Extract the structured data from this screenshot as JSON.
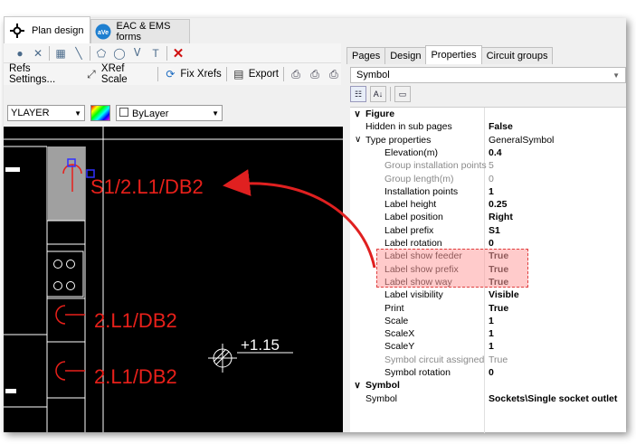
{
  "doc_tabs": [
    {
      "label": "Plan design",
      "active": true,
      "icon": "crosshair-icon"
    },
    {
      "label": "EAC & EMS forms",
      "active": false,
      "icon": "ems-logo-icon"
    }
  ],
  "toolbar2": {
    "xrefs_settings": "Refs Settings...",
    "xref_scale": "XRef Scale",
    "fix_xrefs": "Fix Xrefs",
    "export": "Export"
  },
  "toolbar3": {
    "layer_value": "YLAYER",
    "linetype_value": "ByLayer"
  },
  "canvas": {
    "labels": [
      "S1/2.L1/DB2",
      "2.L1/DB2",
      "2.L1/DB2"
    ],
    "elevation": "+1.15"
  },
  "right_tabs": [
    {
      "label": "Pages",
      "active": false
    },
    {
      "label": "Design",
      "active": false
    },
    {
      "label": "Properties",
      "active": true
    },
    {
      "label": "Circuit groups",
      "active": false
    }
  ],
  "object_combo": "Symbol",
  "properties": [
    {
      "kind": "cat",
      "name": "Figure",
      "value": ""
    },
    {
      "kind": "prop",
      "name": "Hidden in sub pages",
      "value": "False",
      "bold": true,
      "indent": 1
    },
    {
      "kind": "sub",
      "name": "Type properties",
      "value": "GeneralSymbol",
      "bold": false,
      "indent": 1
    },
    {
      "kind": "prop",
      "name": "Elevation(m)",
      "value": "0.4",
      "bold": true,
      "indent": 2
    },
    {
      "kind": "prop",
      "name": "Group installation points",
      "value": "5",
      "gray": true,
      "indent": 2
    },
    {
      "kind": "prop",
      "name": "Group length(m)",
      "value": "0",
      "gray": true,
      "indent": 2
    },
    {
      "kind": "prop",
      "name": "Installation points",
      "value": "1",
      "bold": true,
      "indent": 2
    },
    {
      "kind": "prop",
      "name": "Label height",
      "value": "0.25",
      "bold": true,
      "indent": 2
    },
    {
      "kind": "prop",
      "name": "Label position",
      "value": "Right",
      "bold": true,
      "indent": 2
    },
    {
      "kind": "prop",
      "name": "Label prefix",
      "value": "S1",
      "bold": true,
      "indent": 2
    },
    {
      "kind": "prop",
      "name": "Label rotation",
      "value": "0",
      "bold": true,
      "indent": 2
    },
    {
      "kind": "prop",
      "name": "Label show feeder",
      "value": "True",
      "bold": true,
      "indent": 2
    },
    {
      "kind": "prop",
      "name": "Label show prefix",
      "value": "True",
      "bold": true,
      "indent": 2
    },
    {
      "kind": "prop",
      "name": "Label show way",
      "value": "True",
      "bold": true,
      "indent": 2
    },
    {
      "kind": "prop",
      "name": "Label visibility",
      "value": "Visible",
      "bold": true,
      "indent": 2
    },
    {
      "kind": "prop",
      "name": "Print",
      "value": "True",
      "bold": true,
      "indent": 2
    },
    {
      "kind": "prop",
      "name": "Scale",
      "value": "1",
      "bold": true,
      "indent": 2
    },
    {
      "kind": "prop",
      "name": "ScaleX",
      "value": "1",
      "bold": true,
      "indent": 2
    },
    {
      "kind": "prop",
      "name": "ScaleY",
      "value": "1",
      "bold": true,
      "indent": 2
    },
    {
      "kind": "prop",
      "name": "Symbol circuit assigned",
      "value": "True",
      "gray": true,
      "indent": 2
    },
    {
      "kind": "prop",
      "name": "Symbol rotation",
      "value": "0",
      "bold": true,
      "indent": 2
    },
    {
      "kind": "cat",
      "name": "Symbol",
      "value": ""
    },
    {
      "kind": "prop",
      "name": "Symbol",
      "value": "Sockets\\Single socket outlet",
      "bold": true,
      "indent": 1
    }
  ],
  "colors": {
    "label_red": "#e8201a",
    "highlight_fill": "#ffa0a0",
    "highlight_border": "#e04040",
    "arrow": "#e02020"
  }
}
